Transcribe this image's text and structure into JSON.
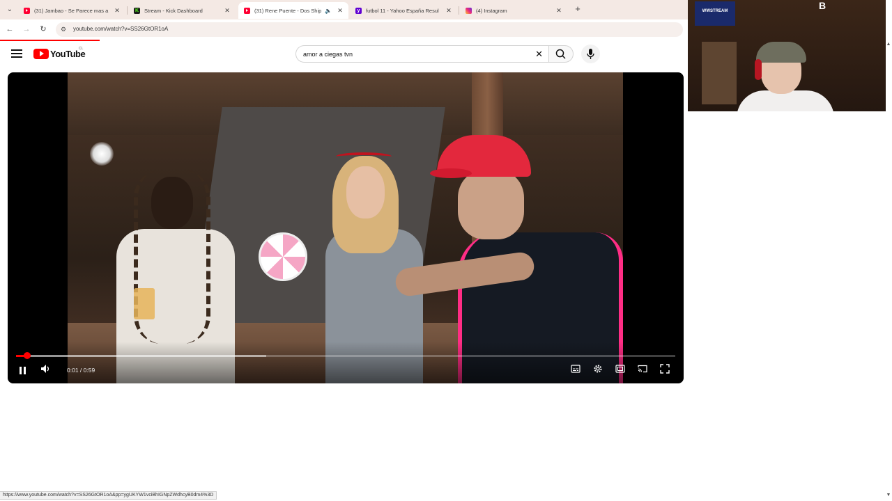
{
  "browser": {
    "tabs": [
      {
        "title": "(31) Jambao - Se Parece mas a",
        "favicon": "youtube-icon"
      },
      {
        "title": "Stream - Kick Dashboard",
        "favicon": "kick-icon"
      },
      {
        "title": "(31) Rene Puente - Dos Ship",
        "favicon": "youtube-icon",
        "active": true
      },
      {
        "title": "futbol 11 - Yahoo España Resul",
        "favicon": "yahoo-icon"
      },
      {
        "title": "(4) Instagram",
        "favicon": "instagram-icon"
      }
    ],
    "url": "youtube.com/watch?v=SS26GtOR1oA",
    "status_url": "https://www.youtube.com/watch?v=SS26GtOR1oA&pp=ygUKYW1vciBhIGNpZWdhcyB0dm4%3D"
  },
  "youtube": {
    "logo_text": "YouTube",
    "country_code": "CL",
    "search": {
      "value": "amor a ciegas tvn"
    },
    "player": {
      "time_display": "0:01 / 0:59",
      "progress": 0.017,
      "buffered": 0.38,
      "state": "playing"
    }
  },
  "webcam": {
    "overlay_text": "WWSTREAM"
  },
  "colors": {
    "accent": "#ff0000",
    "tabstrip": "#f4e9e4"
  }
}
